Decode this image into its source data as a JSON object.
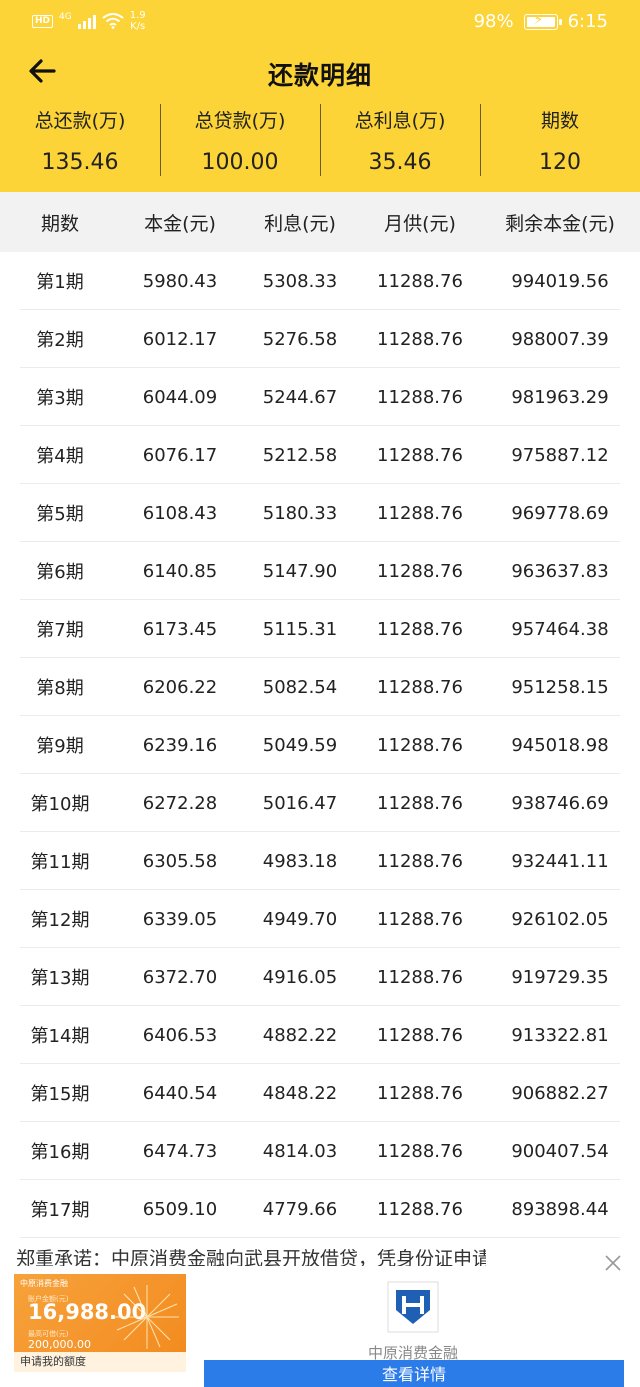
{
  "status_bar": {
    "hd": "HD",
    "network": "4G",
    "speed_value": "1.9",
    "speed_unit": "K/s",
    "battery": "98%",
    "time": "6:15"
  },
  "nav": {
    "title": "还款明细"
  },
  "summary": [
    {
      "label": "总还款(万)",
      "value": "135.46"
    },
    {
      "label": "总贷款(万)",
      "value": "100.00"
    },
    {
      "label": "总利息(万)",
      "value": "35.46"
    },
    {
      "label": "期数",
      "value": "120"
    }
  ],
  "table": {
    "headers": [
      "期数",
      "本金(元)",
      "利息(元)",
      "月供(元)",
      "剩余本金(元)"
    ],
    "rows": [
      [
        "第1期",
        "5980.43",
        "5308.33",
        "11288.76",
        "994019.56"
      ],
      [
        "第2期",
        "6012.17",
        "5276.58",
        "11288.76",
        "988007.39"
      ],
      [
        "第3期",
        "6044.09",
        "5244.67",
        "11288.76",
        "981963.29"
      ],
      [
        "第4期",
        "6076.17",
        "5212.58",
        "11288.76",
        "975887.12"
      ],
      [
        "第5期",
        "6108.43",
        "5180.33",
        "11288.76",
        "969778.69"
      ],
      [
        "第6期",
        "6140.85",
        "5147.90",
        "11288.76",
        "963637.83"
      ],
      [
        "第7期",
        "6173.45",
        "5115.31",
        "11288.76",
        "957464.38"
      ],
      [
        "第8期",
        "6206.22",
        "5082.54",
        "11288.76",
        "951258.15"
      ],
      [
        "第9期",
        "6239.16",
        "5049.59",
        "11288.76",
        "945018.98"
      ],
      [
        "第10期",
        "6272.28",
        "5016.47",
        "11288.76",
        "938746.69"
      ],
      [
        "第11期",
        "6305.58",
        "4983.18",
        "11288.76",
        "932441.11"
      ],
      [
        "第12期",
        "6339.05",
        "4949.70",
        "11288.76",
        "926102.05"
      ],
      [
        "第13期",
        "6372.70",
        "4916.05",
        "11288.76",
        "919729.35"
      ],
      [
        "第14期",
        "6406.53",
        "4882.22",
        "11288.76",
        "913322.81"
      ],
      [
        "第15期",
        "6440.54",
        "4848.22",
        "11288.76",
        "906882.27"
      ],
      [
        "第16期",
        "6474.73",
        "4814.03",
        "11288.76",
        "900407.54"
      ],
      [
        "第17期",
        "6509.10",
        "4779.66",
        "11288.76",
        "893898.44"
      ]
    ]
  },
  "ad": {
    "text": "郑重承诺：中原消费金融向武县开放借贷，凭身份证申请",
    "banner_brand": "中原消费金融",
    "banner_sub": "账户金额(元)",
    "banner_amount": "16,988.00",
    "banner_sub2": "最高可借(元)",
    "banner_amount2": "200,000.00",
    "banner_apply": "申请我的额度",
    "org_name": "中原消费金融",
    "button_label": "查看详情"
  },
  "colors": {
    "header_bg": "#fcd437",
    "table_head_bg": "#f2f2f2",
    "ad_button": "#2b7be8"
  }
}
